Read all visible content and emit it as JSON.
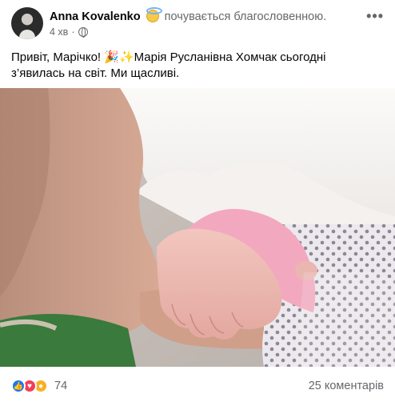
{
  "post": {
    "author": "Anna Kovalenko",
    "feeling_text": "почувається благословенною.",
    "time": "4 хв",
    "separator": "·",
    "more": "•••",
    "text_part1": "Привіт, Марічко! ",
    "text_part2": "Марія Русланівна Хомчак сьогодні з’явилась на світ. Ми щасливі.",
    "party_emoji": "🎉",
    "sparkles_emoji": "✨",
    "reaction_count": "74",
    "comments": "25 коментарів",
    "icons": [
      "globe-icon",
      "more-icon",
      "like-icon",
      "love-icon",
      "wow-icon"
    ],
    "colors": {
      "like": "#1877f2",
      "love": "#f33e58",
      "wow": "#f7b125",
      "meta": "#65676b"
    }
  }
}
